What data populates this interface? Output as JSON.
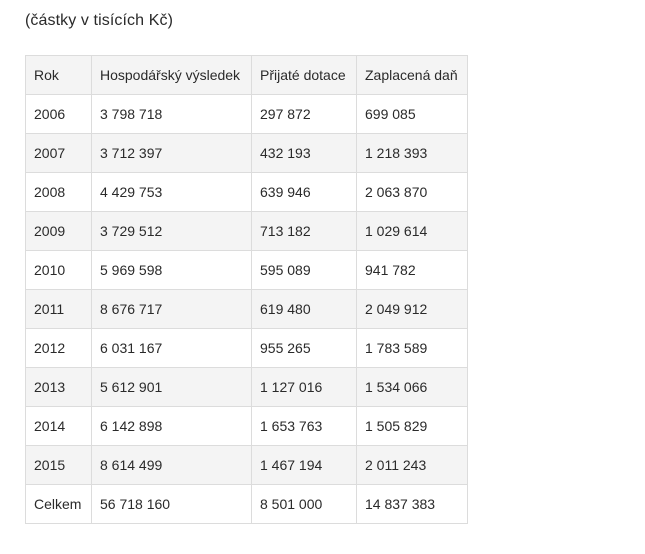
{
  "caption": "(částky v tisících Kč)",
  "table": {
    "headers": [
      "Rok",
      "Hospodářský výsledek",
      "Přijaté dotace",
      "Zaplacená daň"
    ],
    "rows": [
      [
        "2006",
        "3 798 718",
        "297 872",
        "699 085"
      ],
      [
        "2007",
        "3 712 397",
        "432 193",
        "1 218 393"
      ],
      [
        "2008",
        "4 429 753",
        "639 946",
        "2 063 870"
      ],
      [
        "2009",
        "3 729 512",
        "713 182",
        "1 029 614"
      ],
      [
        "2010",
        "5 969 598",
        "595 089",
        "941 782"
      ],
      [
        "2011",
        "8 676 717",
        "619 480",
        "2 049 912"
      ],
      [
        "2012",
        "6 031 167",
        "955 265",
        "1 783 589"
      ],
      [
        "2013",
        "5 612 901",
        "1 127 016",
        "1 534 066"
      ],
      [
        "2014",
        "6 142 898",
        "1 653 763",
        "1 505 829"
      ],
      [
        "2015",
        "8 614 499",
        "1 467 194",
        "2 011 243"
      ],
      [
        "Celkem",
        "56 718 160",
        "8 501 000",
        "14 837 383"
      ]
    ]
  }
}
